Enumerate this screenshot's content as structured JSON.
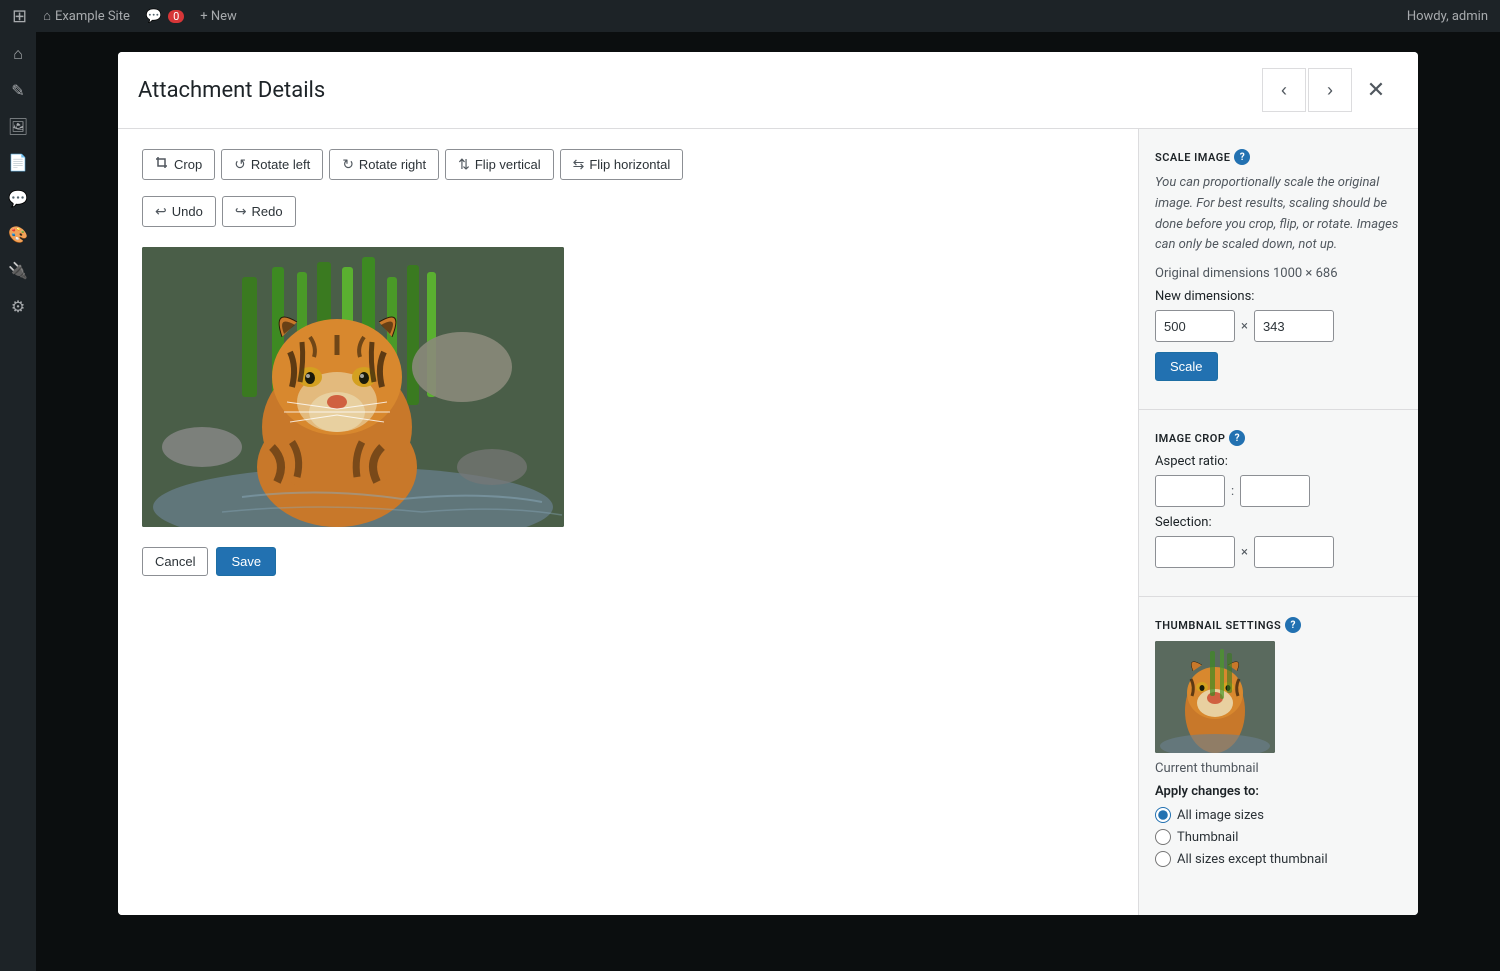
{
  "adminBar": {
    "siteName": "Example Site",
    "commentCount": "0",
    "newLabel": "+ New",
    "howdyText": "Howdy, admin"
  },
  "modal": {
    "title": "Attachment Details",
    "prevLabel": "‹",
    "nextLabel": "›",
    "closeLabel": "✕"
  },
  "toolbar": {
    "cropLabel": "Crop",
    "rotateLeftLabel": "Rotate left",
    "rotateRightLabel": "Rotate right",
    "flipVerticalLabel": "Flip vertical",
    "flipHorizontalLabel": "Flip horizontal",
    "undoLabel": "Undo",
    "redoLabel": "Redo"
  },
  "actions": {
    "cancelLabel": "Cancel",
    "saveLabel": "Save"
  },
  "rightPanel": {
    "scaleImage": {
      "title": "SCALE IMAGE",
      "description": "You can proportionally scale the original image. For best results, scaling should be done before you crop, flip, or rotate. Images can only be scaled down, not up.",
      "originalDimensions": "Original dimensions 1000 × 686",
      "newDimensionsLabel": "New dimensions:",
      "widthValue": "500",
      "heightValue": "343",
      "separator": "×",
      "scaleButtonLabel": "Scale"
    },
    "imageCrop": {
      "title": "IMAGE CROP",
      "aspectRatioLabel": "Aspect ratio:",
      "aspectWidth": "",
      "aspectHeight": "",
      "separator": ":",
      "selectionLabel": "Selection:",
      "selectionWidth": "",
      "selectionHeight": "",
      "selSeparator": "×"
    },
    "thumbnailSettings": {
      "title": "THUMBNAIL SETTINGS",
      "currentThumbnailLabel": "Current thumbnail",
      "applyChangesLabel": "Apply changes to:",
      "options": [
        {
          "id": "all",
          "label": "All image sizes",
          "checked": true
        },
        {
          "id": "thumbnail",
          "label": "Thumbnail",
          "checked": false
        },
        {
          "id": "all-except",
          "label": "All sizes except thumbnail",
          "checked": false
        }
      ]
    }
  },
  "sidebarIcons": [
    "⌂",
    "◈",
    "☰",
    "✎",
    "⬡",
    "✦",
    "◉",
    "⚙"
  ]
}
